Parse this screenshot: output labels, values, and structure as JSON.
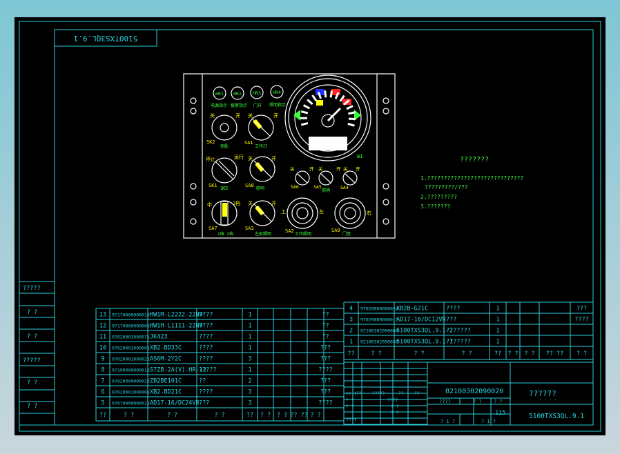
{
  "drawing": {
    "title_mirrored": "5100TXS3QL.9.1",
    "tech_title": "???????",
    "tech_lines": [
      "1.?????????????????????????????",
      "?????????/???",
      "2.?????????",
      "3.???????"
    ]
  },
  "panel": {
    "indicators": [
      "HR1",
      "HR2",
      "HR3",
      "HR4"
    ],
    "indicator_captions": [
      "电源指示",
      "报警指示",
      "门开",
      "照明指示"
    ],
    "switches": [
      {
        "id": "SK2",
        "note": "钥匙",
        "top_left": "关",
        "top_right": "开"
      },
      {
        "id": "SA1",
        "note": "工作灯",
        "top_left": "关",
        "top_right": "开"
      },
      {
        "id": "SK1",
        "note": "调压",
        "top_left": "停止",
        "top_right": "运行"
      },
      {
        "id": "SA8",
        "note": "照明",
        "top_left": "关",
        "top_right": "开"
      },
      {
        "id": "SA7",
        "note": "1档 2档",
        "top_left": "中",
        "top_right": "2档"
      },
      {
        "id": "SA3",
        "note": "左前照明",
        "top_left": "关",
        "top_right": "开"
      },
      {
        "id": "SA6",
        "note": "",
        "top_left": "关",
        "top_right": "开"
      },
      {
        "id": "SA5",
        "note": "照明",
        "top_left": "关",
        "top_right": "开"
      },
      {
        "id": "SA4",
        "note": "",
        "top_left": "关",
        "top_right": "开"
      },
      {
        "id": "SA2",
        "note": "工作照明",
        "top_left": "工",
        "top_right": "左"
      },
      {
        "id": "SA9",
        "note": "门禁",
        "top_left": "",
        "top_right": "右"
      }
    ],
    "gauge_label": "B1"
  },
  "bom_left": {
    "rows": [
      {
        "no": "13",
        "code": "97170000000010",
        "name": "HW1M-L2222-22N9",
        "desc": "????",
        "qty": "1",
        "rem": "??"
      },
      {
        "no": "12",
        "code": "97170000000006",
        "name": "HW1H-L1111-22N9",
        "desc": "????",
        "qty": "1",
        "rem": "??"
      },
      {
        "no": "11",
        "code": "97020001000071",
        "name": "JK423",
        "desc": "????",
        "qty": "1",
        "rem": "??"
      },
      {
        "no": "10",
        "code": "97020001000001",
        "name": "XB2-BD33C",
        "desc": "????",
        "qty": "1",
        "rem": "???"
      },
      {
        "no": "9",
        "code": "97020001000021",
        "name": "AS6M-2Y2C",
        "desc": "????",
        "qty": "3",
        "rem": "???"
      },
      {
        "no": "8",
        "code": "97190000000016",
        "name": "S7ZB-2A(V)-HR-12",
        "desc": "?????",
        "qty": "1",
        "rem": "????"
      },
      {
        "no": "7",
        "code": "97020000000023",
        "name": "ZB2BE101C",
        "desc": "??",
        "qty": "2",
        "rem": "???"
      },
      {
        "no": "6",
        "code": "97020001000001",
        "name": "XB2-BD21C",
        "desc": "????",
        "qty": "3",
        "rem": "???"
      },
      {
        "no": "5",
        "code": "97070000000012",
        "name": "AD17-16/DC24VR",
        "desc": "???",
        "qty": "3",
        "rem": "????"
      }
    ],
    "header": [
      "??",
      "? ?",
      "? ?",
      "? ?",
      "??",
      "? ?",
      "? ?",
      "?? ??",
      "? ?"
    ]
  },
  "bom_right": {
    "rows": [
      {
        "no": "4",
        "code": "97020000000024",
        "name": "XB2B-G21C",
        "desc": "????",
        "qty": "1",
        "rem": "???"
      },
      {
        "no": "3",
        "code": "97020000000011",
        "name": "AD17-16/DC12VR",
        "desc": "???",
        "qty": "1",
        "rem": "????"
      },
      {
        "no": "2",
        "code": "02100302090060",
        "name": "5100TXS3QL.9.1-2",
        "desc": "???????",
        "qty": "1",
        "rem": ""
      },
      {
        "no": "1",
        "code": "02100302090050",
        "name": "5100TXS3QL.9.1-1",
        "desc": "???????",
        "qty": "1",
        "rem": ""
      }
    ],
    "header": [
      "??",
      "? ?",
      "? ?",
      "? ?",
      "??",
      "? ?",
      "? ?",
      "?? ??",
      "? ?"
    ]
  },
  "title_block": {
    "drawing_no": "02100302090020",
    "part_name": "??????",
    "part_name_sub": "· · · ·",
    "title_code": "5100TXS3QL.9.1",
    "scale": "115",
    "left_cells": [
      "?? ?",
      "? ?",
      "????",
      "? ?",
      "? ?",
      "? ?",
      "????"
    ],
    "grid_small": [
      "??",
      "??",
      "?????",
      "??",
      "??"
    ],
    "sheet_marks": [
      "????",
      "? ?",
      "? ?",
      "? 1 ?",
      "? 1 ?"
    ]
  },
  "left_strip": {
    "cells": [
      "?????",
      "? ?",
      "? ?",
      "?????",
      "? ?",
      "? ?"
    ]
  }
}
